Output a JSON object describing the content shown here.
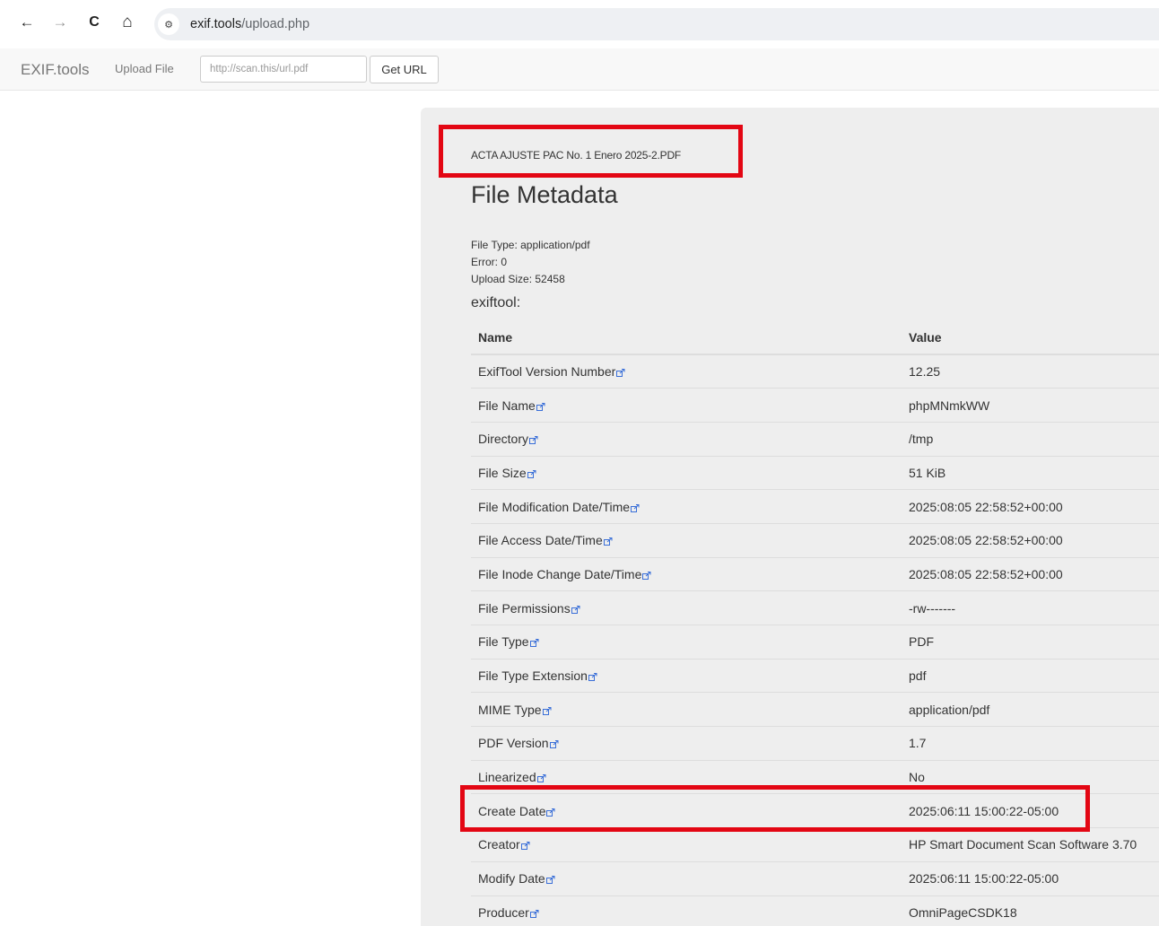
{
  "browser": {
    "back_glyph": "←",
    "forward_glyph": "→",
    "reload_glyph": "C",
    "home_glyph": "⌂",
    "site_info_glyph": "⚙",
    "url_host": "exif.tools",
    "url_path": "/upload.php"
  },
  "navbar": {
    "brand": "EXIF.tools",
    "upload_link": "Upload File",
    "url_placeholder": "http://scan.this/url.pdf",
    "get_url_button": "Get URL"
  },
  "page": {
    "uploaded_file_name": "ACTA AJUSTE PAC No. 1 Enero 2025-2.PDF",
    "title": "File Metadata",
    "file_type_line": "File Type: application/pdf",
    "error_line": "Error: 0",
    "upload_size_line": "Upload Size: 52458",
    "section_label": "exiftool:"
  },
  "table": {
    "headers": {
      "name": "Name",
      "value": "Value"
    },
    "rows": [
      {
        "name": "ExifTool Version Number",
        "value": "12.25"
      },
      {
        "name": "File Name",
        "value": "phpMNmkWW"
      },
      {
        "name": "Directory",
        "value": "/tmp"
      },
      {
        "name": "File Size",
        "value": "51 KiB"
      },
      {
        "name": "File Modification Date/Time",
        "value": "2025:08:05 22:58:52+00:00"
      },
      {
        "name": "File Access Date/Time",
        "value": "2025:08:05 22:58:52+00:00"
      },
      {
        "name": "File Inode Change Date/Time",
        "value": "2025:08:05 22:58:52+00:00"
      },
      {
        "name": "File Permissions",
        "value": "-rw-------"
      },
      {
        "name": "File Type",
        "value": "PDF"
      },
      {
        "name": "File Type Extension",
        "value": "pdf"
      },
      {
        "name": "MIME Type",
        "value": "application/pdf"
      },
      {
        "name": "PDF Version",
        "value": "1.7"
      },
      {
        "name": "Linearized",
        "value": "No"
      },
      {
        "name": "Create Date",
        "value": "2025:06:11 15:00:22-05:00"
      },
      {
        "name": "Creator",
        "value": "HP Smart Document Scan Software 3.70"
      },
      {
        "name": "Modify Date",
        "value": "2025:06:11 15:00:22-05:00"
      },
      {
        "name": "Producer",
        "value": "OmniPageCSDK18"
      }
    ]
  },
  "colors": {
    "highlight": "#e30613",
    "panel_background": "#eeeeee",
    "navbar_background": "#f8f8f8",
    "omnibox_background": "#eef0f3"
  }
}
